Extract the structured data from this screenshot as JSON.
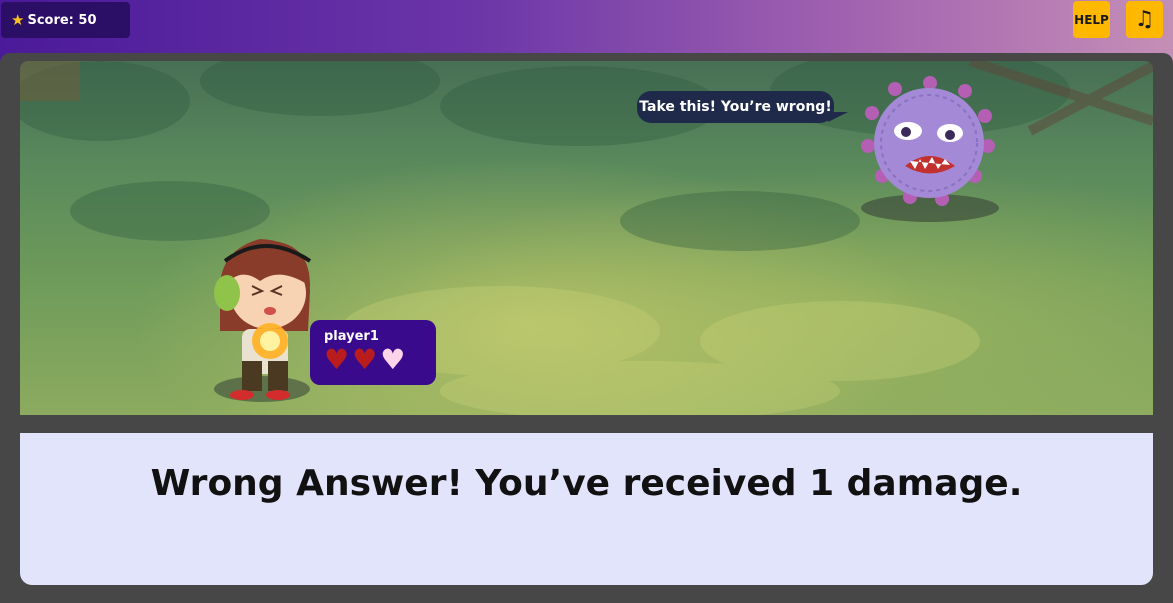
{
  "hud": {
    "score_label": "Score: 50",
    "help_label": "HELP",
    "music_icon": "music-note-icon"
  },
  "scene": {
    "enemy_speech": "Take this! You’re wrong!",
    "player": {
      "name": "player1",
      "hearts": [
        {
          "state": "full"
        },
        {
          "state": "full"
        },
        {
          "state": "empty"
        }
      ],
      "hearts_remaining": 2,
      "hearts_total": 3
    }
  },
  "feedback": {
    "message": "Wrong Answer! You’ve received 1 damage."
  },
  "colors": {
    "score_bg": "#2b0f66",
    "button_bg": "#ffb800",
    "player_card_bg": "#3a0a8c",
    "heart_full": "#b81c1c",
    "heart_empty": "#fbd4ea",
    "panel_bg": "#e2e4fc"
  }
}
